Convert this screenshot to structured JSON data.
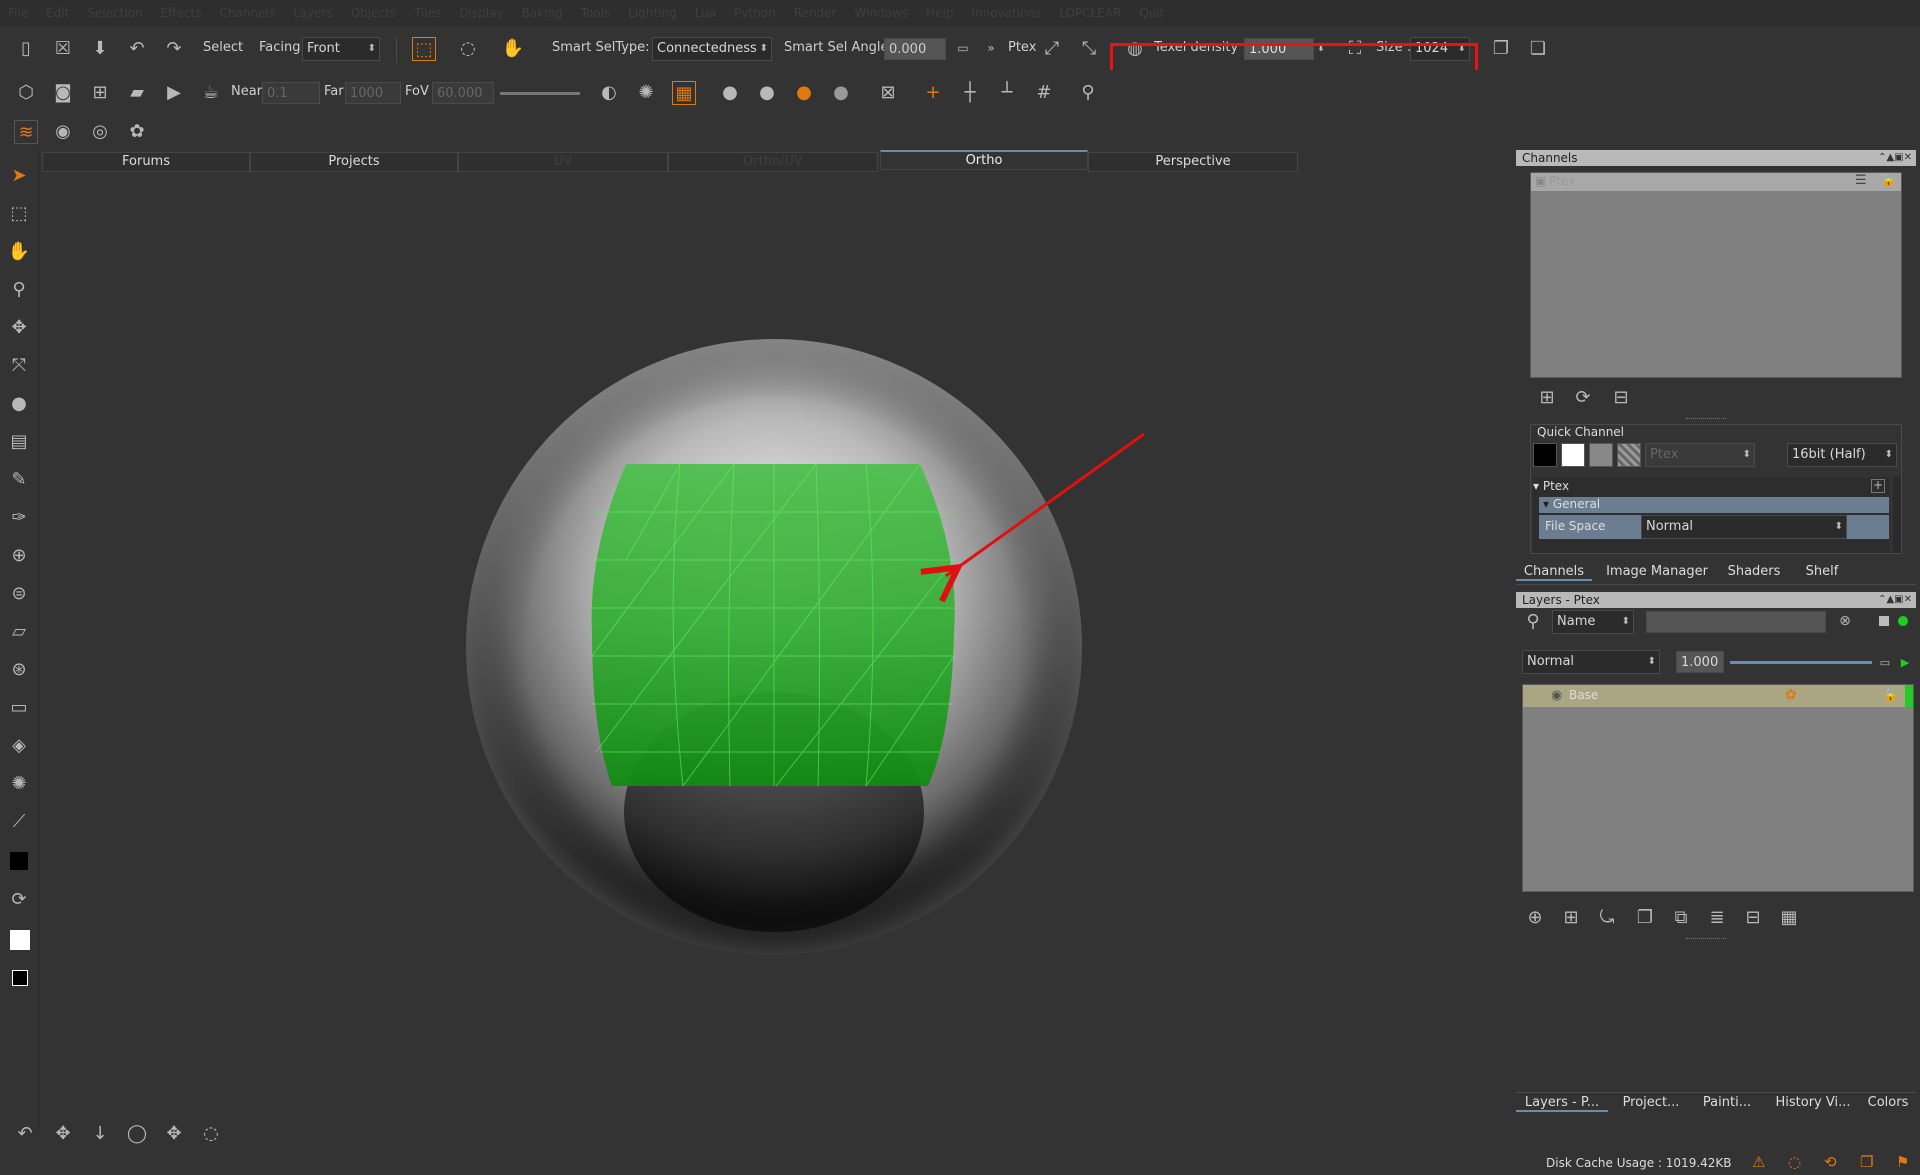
{
  "menubar": {
    "items": [
      "File",
      "Edit",
      "Selection",
      "Effects",
      "Channels",
      "Layers",
      "Objects",
      "Tiles",
      "Display",
      "Baking",
      "Tools",
      "Lighting",
      "Lua",
      "Python",
      "Render",
      "Windows",
      "Help",
      "Innovations",
      "LOPCLEAR",
      "Quit"
    ]
  },
  "toolbar1": {
    "select_label": "Select",
    "facing_label": "Facing",
    "facing_value": "Front",
    "smart_seltype_label": "Smart SelType:",
    "smart_seltype_value": "Connectedness",
    "smart_sel_angle_label": "Smart Sel Angle",
    "smart_sel_angle_value": "0.000",
    "ptex_label": "Ptex",
    "texel_density_label": "Texel density :",
    "texel_density_value": "1.000",
    "size_label": "Size :",
    "size_value": "1024"
  },
  "toolbar2": {
    "near_label": "Near",
    "near_value": "0.1",
    "far_label": "Far",
    "far_value": "1000",
    "fov_label": "FoV",
    "fov_value": "60.000"
  },
  "viewtabs": [
    {
      "label": "Forums",
      "state": "normal"
    },
    {
      "label": "Projects",
      "state": "normal"
    },
    {
      "label": "UV",
      "state": "dim"
    },
    {
      "label": "Ortho/UV",
      "state": "dim"
    },
    {
      "label": "Ortho",
      "state": "active"
    },
    {
      "label": "Perspective",
      "state": "normal"
    }
  ],
  "channels_panel": {
    "title": "Channels",
    "channel_item": "Ptex",
    "quick_channel_label": "Quick Channel",
    "quick_channel_name_placeholder": "Ptex",
    "bitdepth_value": "16bit (Half)",
    "section_ptex": "Ptex",
    "section_general": "General",
    "file_space_label": "File Space",
    "file_space_value": "Normal"
  },
  "panel_tabs_top": [
    "Channels",
    "Image Manager",
    "Shaders",
    "Shelf"
  ],
  "layers_panel": {
    "title": "Layers - Ptex",
    "filter_field": "Name",
    "blend_mode": "Normal",
    "opacity_value": "1.000",
    "layer_name": "Base"
  },
  "panel_tabs_bottom": [
    "Layers - P...",
    "Project...",
    "Painti...",
    "History Vi...",
    "Colors"
  ],
  "status": {
    "disk_cache": "Disk Cache Usage : 1019.42KB"
  },
  "colors": {
    "accent_orange": "#e07a10",
    "highlight_red": "#e01010",
    "patch_green": "#2fb32f"
  }
}
